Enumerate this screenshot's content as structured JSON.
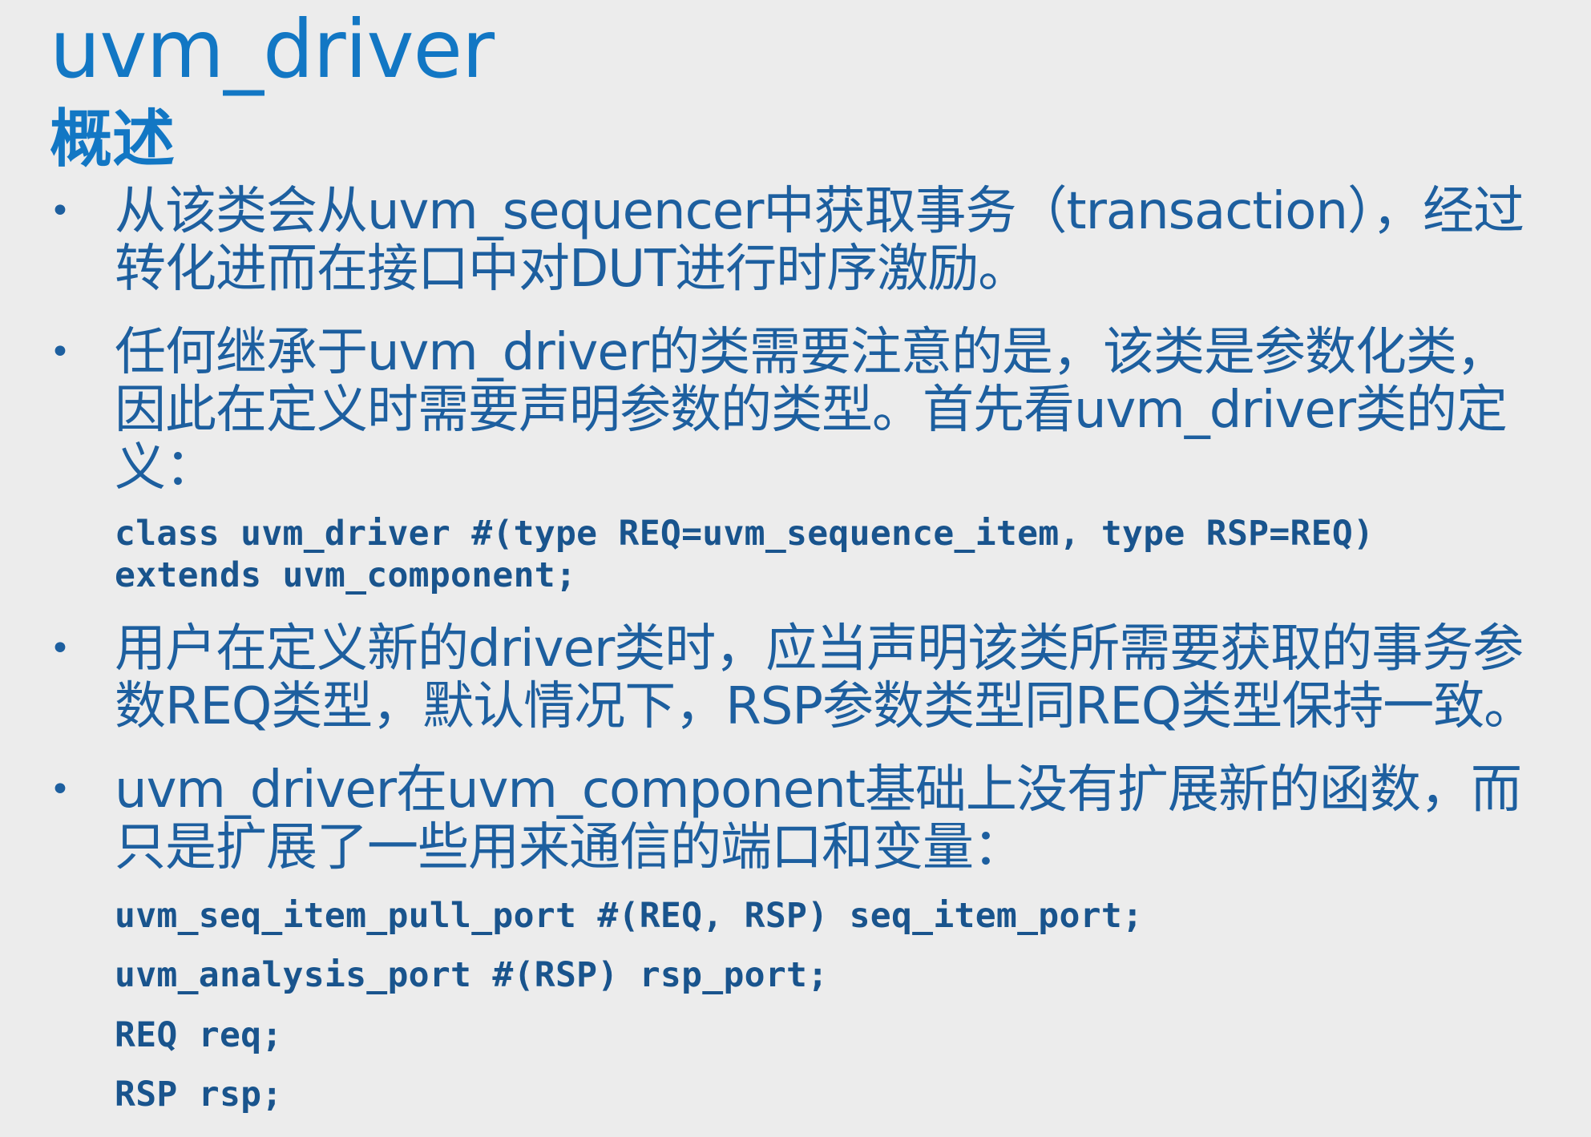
{
  "slide": {
    "title": "uvm_driver",
    "subtitle": "概述",
    "bullet_symbol": "•",
    "bullets": [
      {
        "lines": [
          "从该类会从uvm_sequencer中获取事务（transaction），经过",
          "转化进而在接口中对DUT进行时序激励。"
        ]
      },
      {
        "lines": [
          "任何继承于uvm_driver的类需要注意的是，该类是参数化类，",
          "因此在定义时需要声明参数的类型。首先看uvm_driver类的定",
          "义："
        ],
        "code": [
          "class uvm_driver #(type REQ=uvm_sequence_item, type RSP=REQ)",
          "extends uvm_component;"
        ]
      },
      {
        "lines": [
          "用户在定义新的driver类时，应当声明该类所需要获取的事务参",
          "数REQ类型，默认情况下，RSP参数类型同REQ类型保持一致。"
        ]
      },
      {
        "lines": [
          "uvm_driver在uvm_component基础上没有扩展新的函数，而",
          "只是扩展了一些用来通信的端口和变量："
        ],
        "code": [
          "uvm_seq_item_pull_port #(REQ, RSP) seq_item_port;",
          "uvm_analysis_port #(RSP) rsp_port;",
          "REQ req;",
          "RSP rsp;"
        ]
      }
    ]
  },
  "colors": {
    "background": "#ececec",
    "title": "#1277c4",
    "body_text": "#1d5f9f",
    "code_text": "#19548d"
  }
}
